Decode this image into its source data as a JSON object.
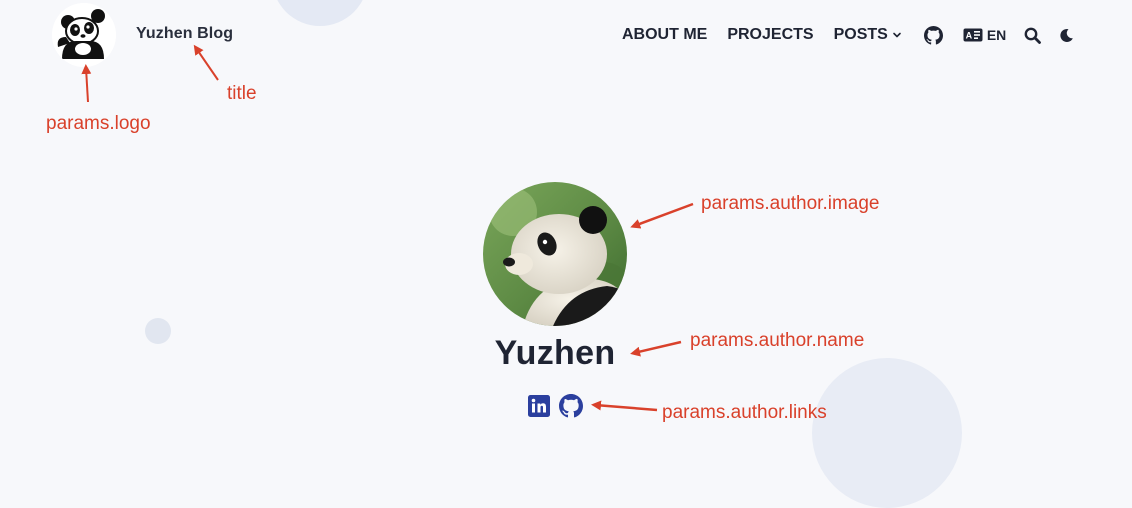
{
  "header": {
    "logo_icon": "panda-logo-icon",
    "title": "Yuzhen Blog",
    "nav": [
      {
        "label": "ABOUT ME"
      },
      {
        "label": "PROJECTS"
      },
      {
        "label": "POSTS",
        "icon": "chevron-down-icon"
      }
    ],
    "github_icon": "github-icon",
    "language": {
      "icon": "language-card-icon",
      "label": "EN"
    },
    "search_icon": "search-icon",
    "theme_icon": "moon-icon"
  },
  "profile": {
    "image": "panda-photo",
    "name": "Yuzhen",
    "links": [
      {
        "icon": "linkedin-icon"
      },
      {
        "icon": "github-icon"
      }
    ]
  },
  "annotations": {
    "logo": "params.logo",
    "title": "title",
    "author_image": "params.author.image",
    "author_name": "params.author.name",
    "author_links": "params.author.links"
  },
  "colors": {
    "background": "#f7f8fb",
    "text": "#1f2433",
    "annotation": "#d9412b",
    "social_icons": "#2b3f9e"
  }
}
